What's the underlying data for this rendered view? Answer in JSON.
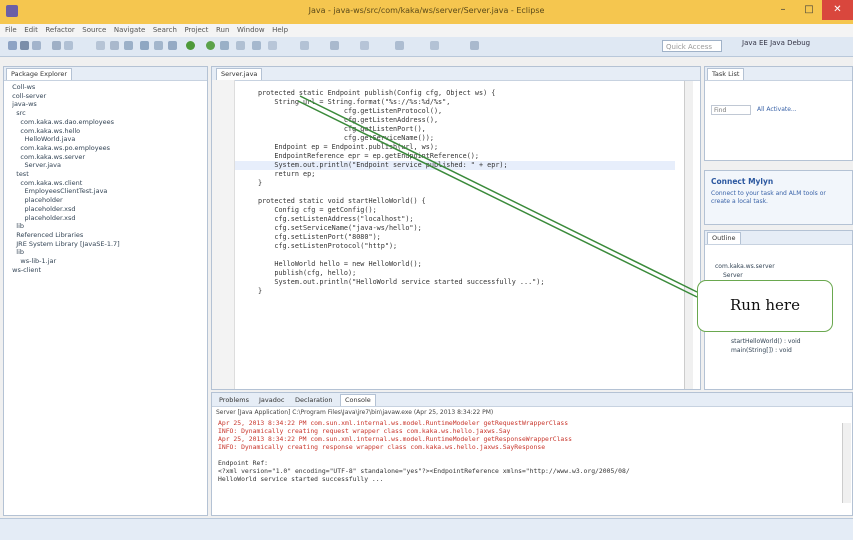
{
  "window": {
    "title": "Java - java-ws/src/com/kaka/ws/server/Server.java - Eclipse",
    "minimize": "–",
    "maximize": "□",
    "close": "✕"
  },
  "menu": [
    "File",
    "Edit",
    "Refactor",
    "Source",
    "Navigate",
    "Search",
    "Project",
    "Run",
    "Window",
    "Help"
  ],
  "toolbar": {
    "quick_access_placeholder": "Quick Access",
    "perspectives": "Java EE   Java   Debug"
  },
  "package_explorer": {
    "tab_label": "Package Explorer",
    "tree": [
      "  Coll-ws",
      "  coll-server",
      "  java-ws",
      "    src",
      "      com.kaka.ws.dao.employees",
      "      com.kaka.ws.hello",
      "        HelloWorld.java",
      "      com.kaka.ws.po.employees",
      "      com.kaka.ws.server",
      "        Server.java",
      "    test",
      "      com.kaka.ws.client",
      "        EmployeesClientTest.java",
      "        placeholder",
      "        placeholder.xsd",
      "        placeholder.xsd",
      "    lib",
      "    Referenced Libraries",
      "    JRE System Library [JavaSE-1.7]",
      "    lib",
      "      ws-lib-1.jar",
      "  ws-client"
    ]
  },
  "editor": {
    "tab_label": "Server.java",
    "code": [
      "protected static Endpoint publish(Config cfg, Object ws) {",
      "    String url = String.format(\"%s://%s:%d/%s\",",
      "                     cfg.getListenProtocol(),",
      "                     cfg.getListenAddress(),",
      "                     cfg.getListenPort(),",
      "                     cfg.getServiceName());",
      "    Endpoint ep = Endpoint.publish(url, ws);",
      "    EndpointReference epr = ep.getEndpointReference();",
      "    System.out.println(\"Endpoint service published: \" + epr);",
      "    return ep;",
      "}",
      "",
      "protected static void startHelloWorld() {",
      "    Config cfg = getConfig();",
      "    cfg.setListenAddress(\"localhost\");",
      "    cfg.setServiceName(\"java-ws/hello\");",
      "    cfg.setListenPort(\"8080\");",
      "    cfg.setListenProtocol(\"http\");",
      "",
      "    HelloWorld hello = new HelloWorld();",
      "    publish(cfg, hello);",
      "    System.out.println(\"HelloWorld service started successfully ...\");",
      "}"
    ]
  },
  "task_list": {
    "tab_label": "Task List",
    "find_placeholder": "Find",
    "filter": "All  Activate..."
  },
  "mylyn": {
    "title": "Connect Mylyn",
    "text": "Connect to your task and ALM tools or create a local task."
  },
  "outline": {
    "tab_label": "Outline",
    "items": [
      "com.kaka.ws.server",
      "Server",
      "startHelloWorld() : void",
      "main(String[]) : void"
    ]
  },
  "console": {
    "tabs": [
      "Problems",
      "Javadoc",
      "Declaration",
      "Console"
    ],
    "header": "Server [Java Application] C:\\Program Files\\Java\\jre7\\bin\\javaw.exe (Apr 25, 2013 8:34:22 PM)",
    "lines_red": [
      "Apr 25, 2013 8:34:22 PM com.sun.xml.internal.ws.model.RuntimeModeler getRequestWrapperClass",
      "INFO: Dynamically creating request wrapper class com.kaka.ws.hello.jaxws.Say",
      "Apr 25, 2013 8:34:22 PM com.sun.xml.internal.ws.model.RuntimeModeler getResponseWrapperClass",
      "INFO: Dynamically creating response wrapper class com.kaka.ws.hello.jaxws.SayResponse"
    ],
    "lines_dark": [
      "Endpoint Ref:",
      "<?xml version=\"1.0\" encoding=\"UTF-8\" standalone=\"yes\"?><EndpointReference xmlns=\"http://www.w3.org/2005/08/",
      "HelloWorld service started successfully ..."
    ]
  },
  "callout": {
    "text": "Run here"
  },
  "colors": {
    "title_bar": "#f5c64f",
    "callout_border": "#6aa84f",
    "arrow": "#3a8a3a",
    "console_error": "#c8352b"
  }
}
